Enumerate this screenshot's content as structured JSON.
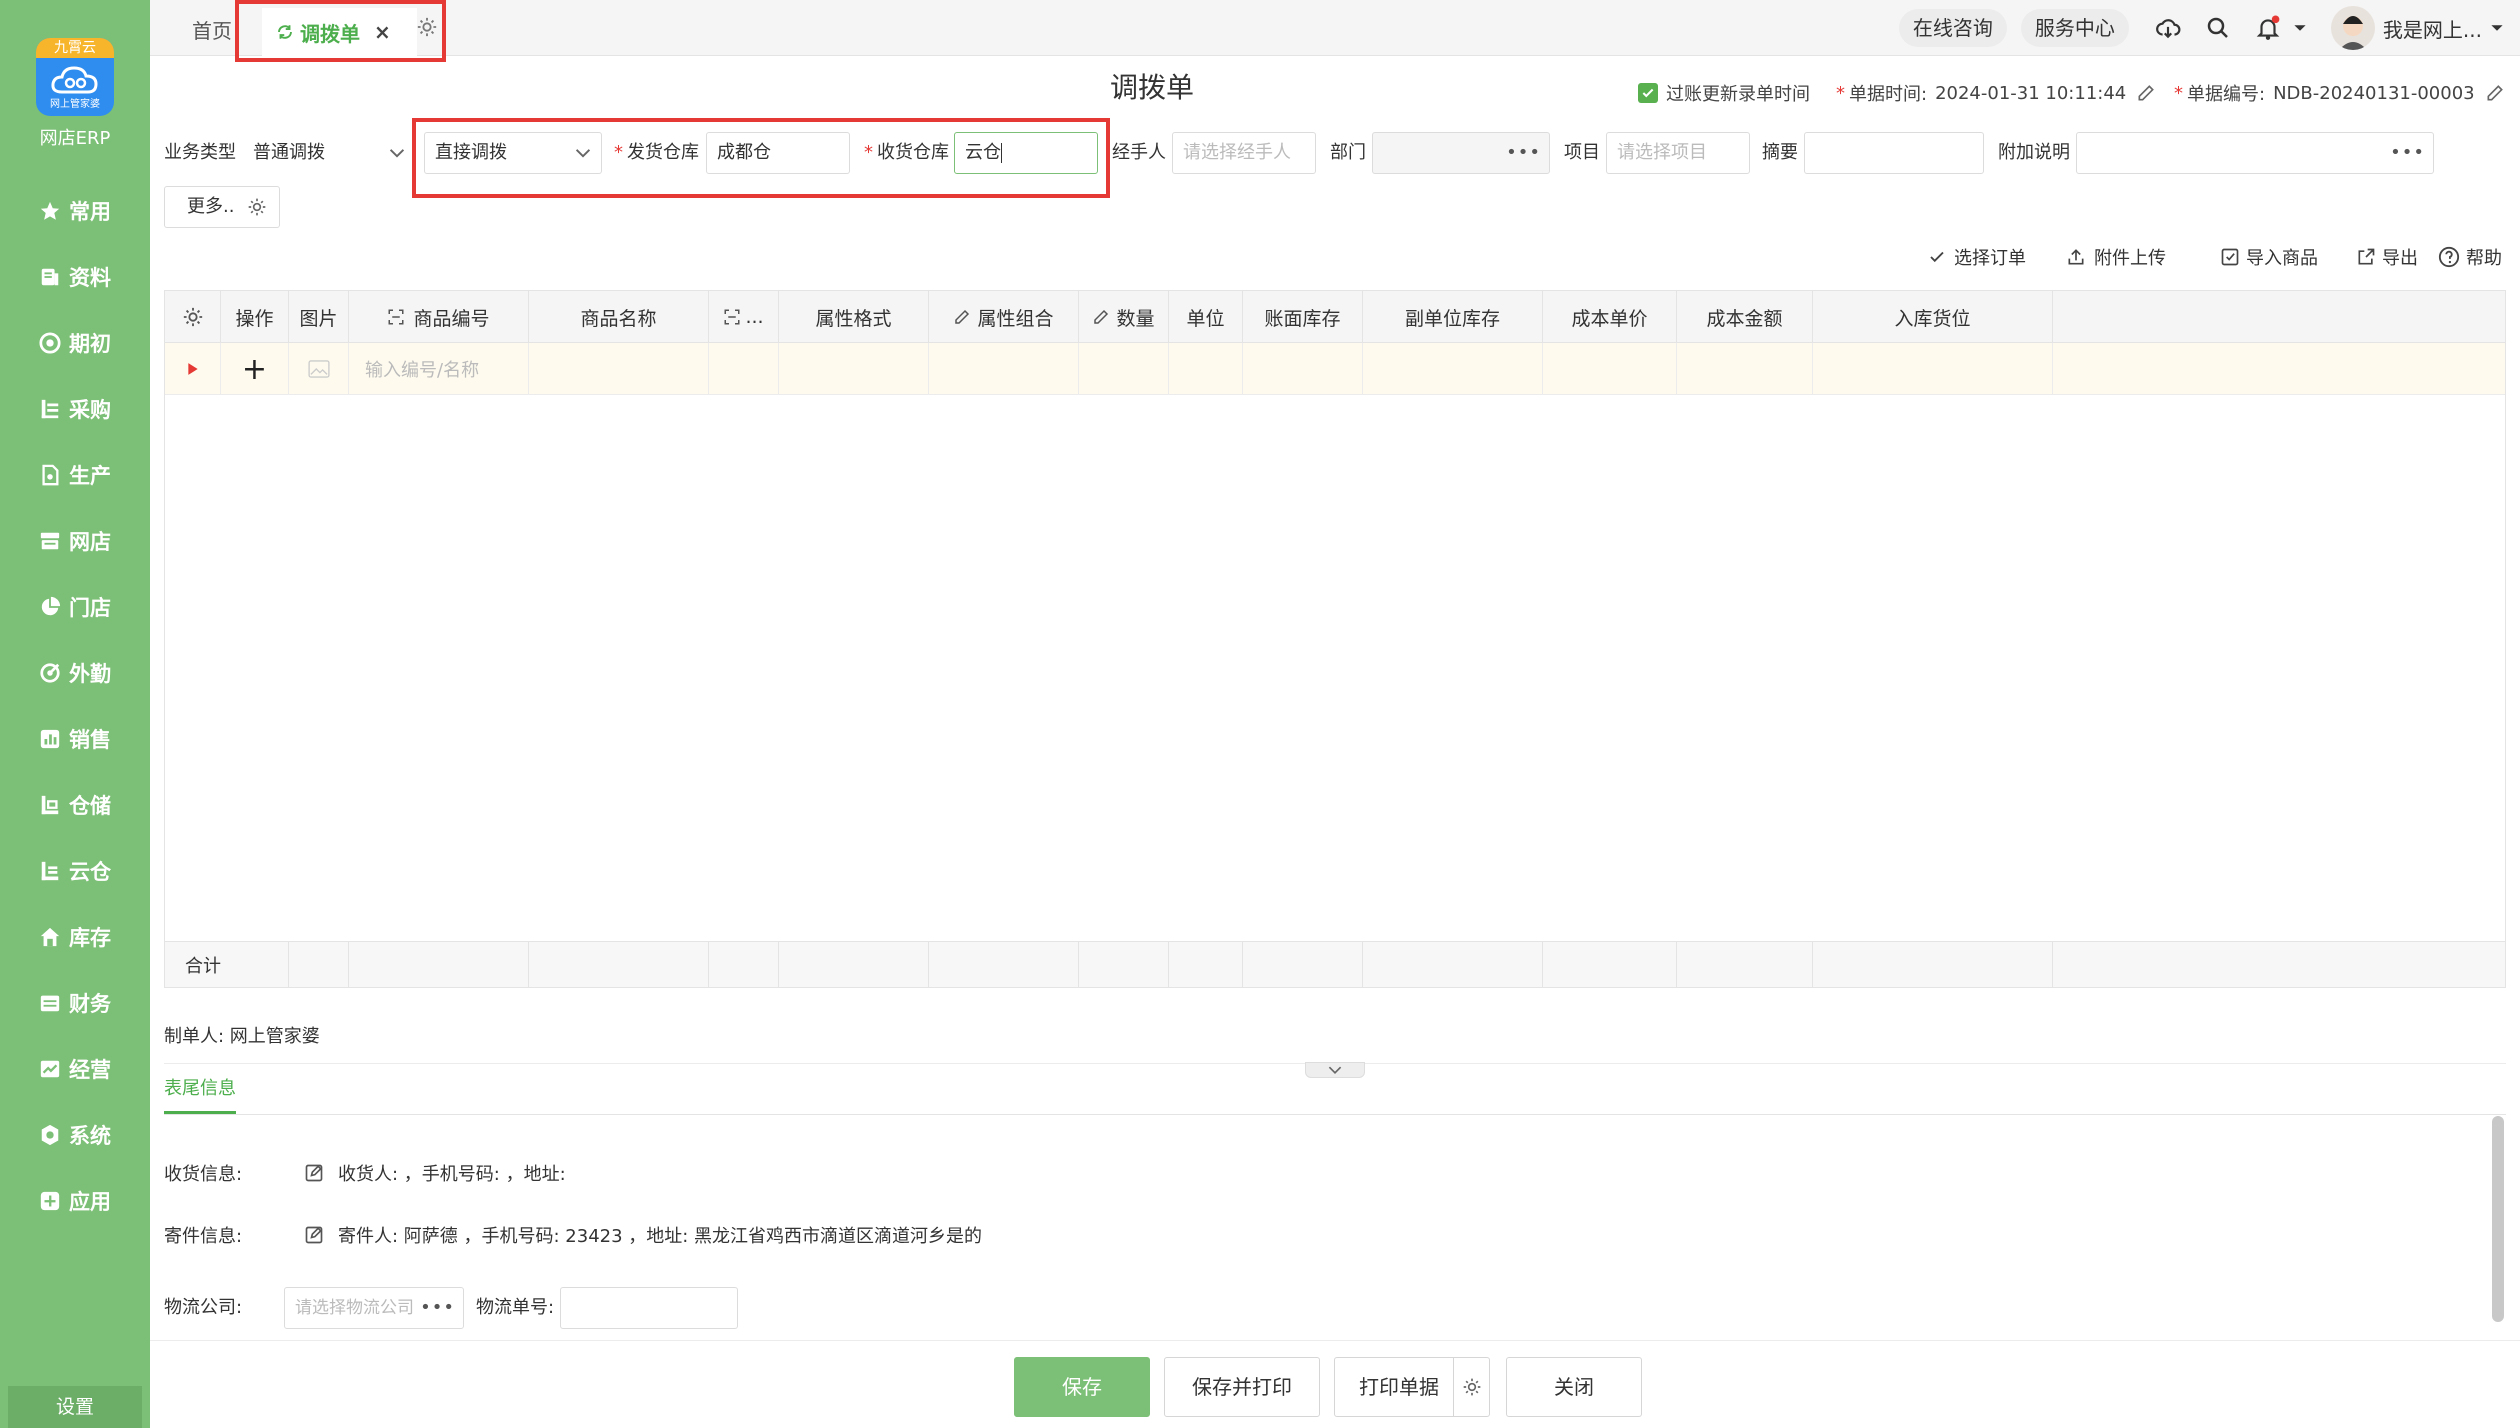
{
  "app": {
    "brand": "网店ERP",
    "logo_ribbon": "九霄云",
    "logo_sub": "网上管家婆",
    "settings": "设置"
  },
  "nav": [
    {
      "label": "常用",
      "icon": "star-icon"
    },
    {
      "label": "资料",
      "icon": "document-icon"
    },
    {
      "label": "期初",
      "icon": "target-icon"
    },
    {
      "label": "采购",
      "icon": "list-icon"
    },
    {
      "label": "生产",
      "icon": "file-icon"
    },
    {
      "label": "网店",
      "icon": "shop-icon"
    },
    {
      "label": "门店",
      "icon": "pie-icon"
    },
    {
      "label": "外勤",
      "icon": "compass-icon"
    },
    {
      "label": "销售",
      "icon": "bar-chart-icon"
    },
    {
      "label": "仓储",
      "icon": "warehouse-icon"
    },
    {
      "label": "云仓",
      "icon": "cloud-warehouse-icon"
    },
    {
      "label": "库存",
      "icon": "home-icon"
    },
    {
      "label": "财务",
      "icon": "wallet-icon"
    },
    {
      "label": "经营",
      "icon": "chart-icon"
    },
    {
      "label": "系统",
      "icon": "gear-icon"
    },
    {
      "label": "应用",
      "icon": "plus-icon"
    }
  ],
  "tabs": {
    "home": "首页",
    "active": "调拨单",
    "close": "×"
  },
  "topbar": {
    "consult": "在线咨询",
    "service": "服务中心",
    "user": "我是网上..."
  },
  "page": {
    "title": "调拨单"
  },
  "meta": {
    "update_time_label": "过账更新录单时间",
    "date_label": "单据时间:",
    "date_value": "2024-01-31 10:11:44",
    "no_label": "单据编号:",
    "no_value": "NDB-20240131-00003",
    "required": "*"
  },
  "form": {
    "biz_type_label": "业务类型",
    "biz_type_value": "普通调拨",
    "mode_value": "直接调拨",
    "from_label": "发货仓库",
    "from_value": "成都仓",
    "to_label": "收货仓库",
    "to_value": "云仓",
    "handler_label": "经手人",
    "handler_placeholder": "请选择经手人",
    "dept_label": "部门",
    "project_label": "项目",
    "project_placeholder": "请选择项目",
    "summary_label": "摘要",
    "note_label": "附加说明",
    "more": "更多.."
  },
  "toolbar": {
    "select_order": "选择订单",
    "upload": "附件上传",
    "import": "导入商品",
    "export": "导出",
    "help": "帮助"
  },
  "grid": {
    "headers": [
      "操作",
      "图片",
      "商品编号",
      "商品名称",
      "...",
      "属性格式",
      "属性组合",
      "数量",
      "单位",
      "账面库存",
      "副单位库存",
      "成本单价",
      "成本金额",
      "入库货位"
    ],
    "row_placeholder": "输入编号/名称",
    "add": "+",
    "total": "合计"
  },
  "footer": {
    "maker": "制单人: 网上管家婆",
    "tab": "表尾信息",
    "recv_label": "收货信息:",
    "recv_value": "收货人: ，手机号码: ，地址:",
    "send_label": "寄件信息:",
    "send_value": "寄件人: 阿萨德 ，手机号码: 23423 ，地址: 黑龙江省鸡西市滴道区滴道河乡是的",
    "logistics_label": "物流公司:",
    "logistics_placeholder": "请选择物流公司",
    "tracking_label": "物流单号:"
  },
  "buttons": {
    "save": "保存",
    "save_print": "保存并打印",
    "print": "打印单据",
    "close": "关闭"
  },
  "colors": {
    "sidebar": "#7cbf76",
    "accent": "#4cae4c",
    "highlight": "#e53935"
  }
}
